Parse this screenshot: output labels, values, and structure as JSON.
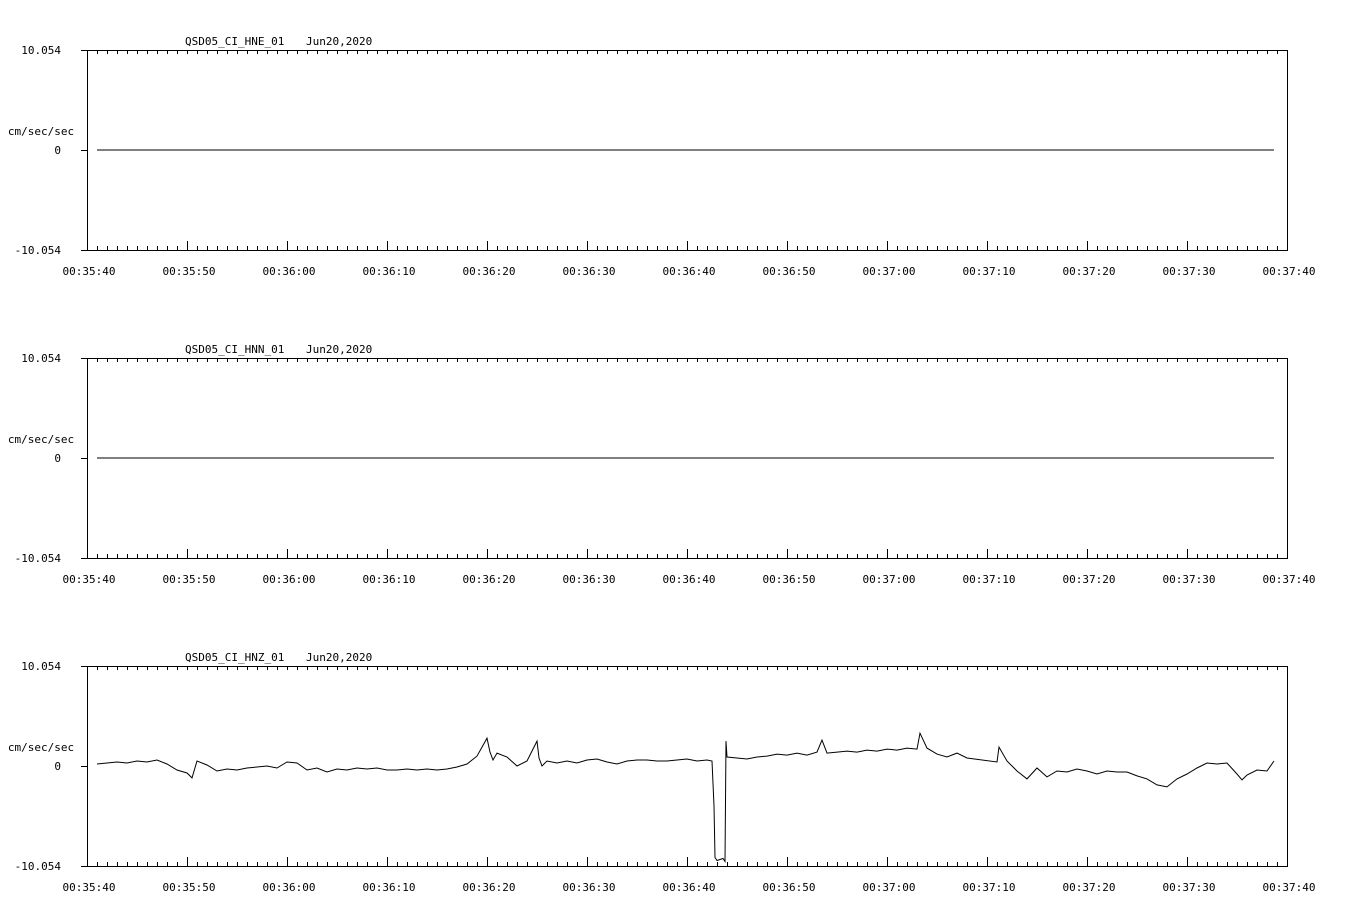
{
  "chart_data": [
    {
      "type": "line",
      "title": "QSD05_CI_HNE_01",
      "date": "Jun20,2020",
      "ylabel": "cm/sec/sec",
      "ylim": [
        -10.054,
        10.054
      ],
      "y_tick_labels": [
        "10.054",
        "0",
        "-10.054"
      ],
      "x_tick_labels": [
        "00:35:40",
        "00:35:50",
        "00:36:00",
        "00:36:10",
        "00:36:20",
        "00:36:30",
        "00:36:40",
        "00:36:50",
        "00:37:00",
        "00:37:10",
        "00:37:20",
        "00:37:30",
        "00:37:40"
      ],
      "x_range_seconds": [
        0,
        120
      ],
      "series": [
        {
          "x": [
            1,
            118.7
          ],
          "y": [
            0,
            0
          ]
        }
      ]
    },
    {
      "type": "line",
      "title": "QSD05_CI_HNN_01",
      "date": "Jun20,2020",
      "ylabel": "cm/sec/sec",
      "ylim": [
        -10.054,
        10.054
      ],
      "y_tick_labels": [
        "10.054",
        "0",
        "-10.054"
      ],
      "x_tick_labels": [
        "00:35:40",
        "00:35:50",
        "00:36:00",
        "00:36:10",
        "00:36:20",
        "00:36:30",
        "00:36:40",
        "00:36:50",
        "00:37:00",
        "00:37:10",
        "00:37:20",
        "00:37:30",
        "00:37:40"
      ],
      "x_range_seconds": [
        0,
        120
      ],
      "series": [
        {
          "x": [
            1,
            118.7
          ],
          "y": [
            0,
            0
          ]
        }
      ]
    },
    {
      "type": "line",
      "title": "QSD05_CI_HNZ_01",
      "date": "Jun20,2020",
      "ylabel": "cm/sec/sec",
      "ylim": [
        -10.054,
        10.054
      ],
      "y_tick_labels": [
        "10.054",
        "0",
        "-10.054"
      ],
      "x_tick_labels": [
        "00:35:40",
        "00:35:50",
        "00:36:00",
        "00:36:10",
        "00:36:20",
        "00:36:30",
        "00:36:40",
        "00:36:50",
        "00:37:00",
        "00:37:10",
        "00:37:20",
        "00:37:30",
        "00:37:40"
      ],
      "x_range_seconds": [
        0,
        120
      ],
      "series": [
        {
          "x": [
            1,
            2,
            3,
            4,
            5,
            6,
            7,
            8,
            9,
            10,
            10.5,
            11,
            12,
            13,
            14,
            15,
            16,
            17,
            18,
            19,
            20,
            21,
            22,
            23,
            24,
            25,
            26,
            27,
            28,
            29,
            30,
            31,
            32,
            33,
            34,
            35,
            36,
            37,
            38,
            39,
            40,
            40.3,
            40.6,
            41,
            42,
            43,
            44,
            45,
            45.2,
            45.5,
            46,
            47,
            48,
            49,
            50,
            51,
            52,
            53,
            54,
            55,
            56,
            57,
            58,
            59,
            60,
            61,
            62,
            62.5,
            62.7,
            62.8,
            63,
            63.6,
            63.8,
            63.9,
            64,
            65,
            66,
            67,
            68,
            69,
            70,
            71,
            72,
            73,
            73.5,
            74,
            75,
            76,
            77,
            78,
            79,
            80,
            81,
            82,
            83,
            83.3,
            84,
            85,
            86,
            87,
            88,
            91,
            91.2,
            92,
            93,
            94,
            95,
            96,
            97,
            98,
            99,
            100,
            101,
            102,
            103,
            104,
            105,
            106,
            107,
            108,
            109,
            110,
            111,
            112,
            113,
            114,
            115,
            115.5,
            116,
            117,
            118,
            118.7
          ],
          "y": [
            0.2,
            0.3,
            0.4,
            0.3,
            0.5,
            0.4,
            0.6,
            0.2,
            -0.4,
            -0.7,
            -1.2,
            0.5,
            0.1,
            -0.5,
            -0.3,
            -0.4,
            -0.2,
            -0.1,
            0.0,
            -0.2,
            0.4,
            0.3,
            -0.4,
            -0.2,
            -0.6,
            -0.3,
            -0.4,
            -0.2,
            -0.3,
            -0.2,
            -0.4,
            -0.4,
            -0.3,
            -0.4,
            -0.3,
            -0.4,
            -0.3,
            -0.1,
            0.2,
            1.0,
            2.8,
            1.4,
            0.6,
            1.3,
            0.9,
            0.0,
            0.5,
            2.5,
            0.8,
            0.0,
            0.5,
            0.3,
            0.5,
            0.3,
            0.6,
            0.7,
            0.4,
            0.2,
            0.5,
            0.6,
            0.6,
            0.5,
            0.5,
            0.6,
            0.7,
            0.5,
            0.6,
            0.5,
            -4.0,
            -9.2,
            -9.5,
            -9.3,
            -9.6,
            2.5,
            0.9,
            0.8,
            0.7,
            0.9,
            1.0,
            1.2,
            1.1,
            1.3,
            1.1,
            1.4,
            2.6,
            1.3,
            1.4,
            1.5,
            1.4,
            1.6,
            1.5,
            1.7,
            1.6,
            1.8,
            1.7,
            3.3,
            1.8,
            1.2,
            0.9,
            1.3,
            0.8,
            0.4,
            1.9,
            0.5,
            -0.5,
            -1.3,
            -0.2,
            -1.1,
            -0.5,
            -0.6,
            -0.3,
            -0.5,
            -0.8,
            -0.5,
            -0.6,
            -0.6,
            -1.0,
            -1.3,
            -1.9,
            -2.1,
            -1.3,
            -0.8,
            -0.2,
            0.3,
            0.2,
            0.3,
            -0.8,
            -1.4,
            -0.9,
            -0.4,
            -0.5,
            0.5
          ]
        }
      ]
    }
  ]
}
